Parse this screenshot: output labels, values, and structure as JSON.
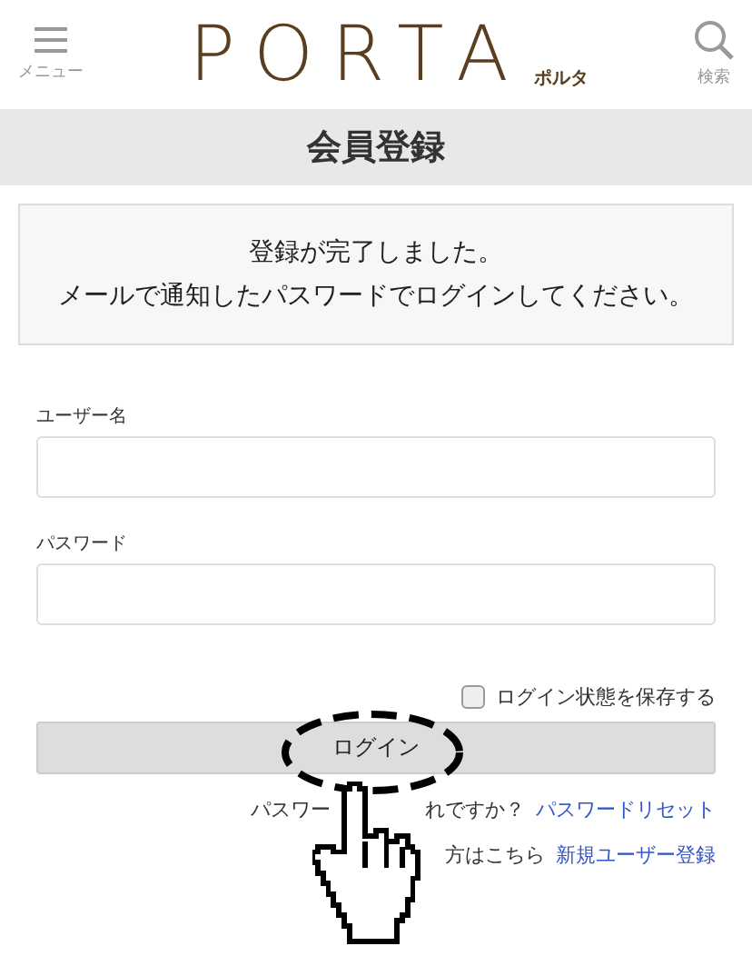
{
  "header": {
    "menu_label": "メニュー",
    "logo": "PORTA",
    "logo_sub": "ポルタ",
    "search_label": "検索"
  },
  "page_title": "会員登録",
  "message_lines": [
    "登録が完了しました。",
    "メールで通知したパスワードでログインしてください。"
  ],
  "fields": [
    {
      "label": "ユーザー名"
    },
    {
      "label": "パスワード"
    }
  ],
  "remember": {
    "label": "ログイン状態を保存する",
    "checked": false
  },
  "login_button": "ログイン",
  "links": [
    {
      "prefix": "パスワー",
      "prefix_2": "れですか？",
      "link": "パスワードリセット"
    },
    {
      "prefix_2": "方はこちら",
      "link": "新規ユーザー登録"
    }
  ]
}
